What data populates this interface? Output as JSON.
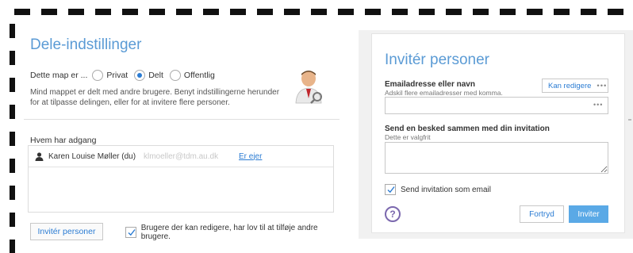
{
  "share_settings": {
    "title": "Dele-indstillinger",
    "share_label": "Dette map er ...",
    "options": [
      "Privat",
      "Delt",
      "Offentlig"
    ],
    "selected": "Delt",
    "description": "Mind mappet er delt med andre brugere. Benyt indstillingerne herunder for at tilpasse delingen, eller for at invitere flere personer.",
    "avatar_icon": "user-with-magnifier-icon"
  },
  "access": {
    "title": "Hvem har adgang",
    "people": [
      {
        "name": "Karen Louise Møller (du)",
        "email": "klmoeller@tdm.au.dk",
        "role": "Er ejer"
      }
    ]
  },
  "bottom_bar": {
    "invite_button": "Invitér personer",
    "editors_can_add_label": "Brugere der kan redigere, har lov til at tilføje andre brugere.",
    "editors_can_add_checked": true
  },
  "invite_dialog": {
    "title": "Invitér personer",
    "email_label": "Emailadresse eller navn",
    "email_hint": "Adskil flere emailadresser med komma.",
    "email_value": "",
    "permission_button": "Kan redigere",
    "dots": "•••",
    "message_label": "Send en besked sammen med din invitation",
    "message_hint": "Dette er valgfrit",
    "message_value": "",
    "send_email_label": "Send invitation som email",
    "send_email_checked": true,
    "help_glyph": "?",
    "cancel_button": "Fortryd",
    "invite_button": "Inviter"
  },
  "colors": {
    "accent": "#5b9bd5",
    "link": "#2b7cd3",
    "primary_button": "#5aa9e6",
    "help": "#7b68ae"
  }
}
